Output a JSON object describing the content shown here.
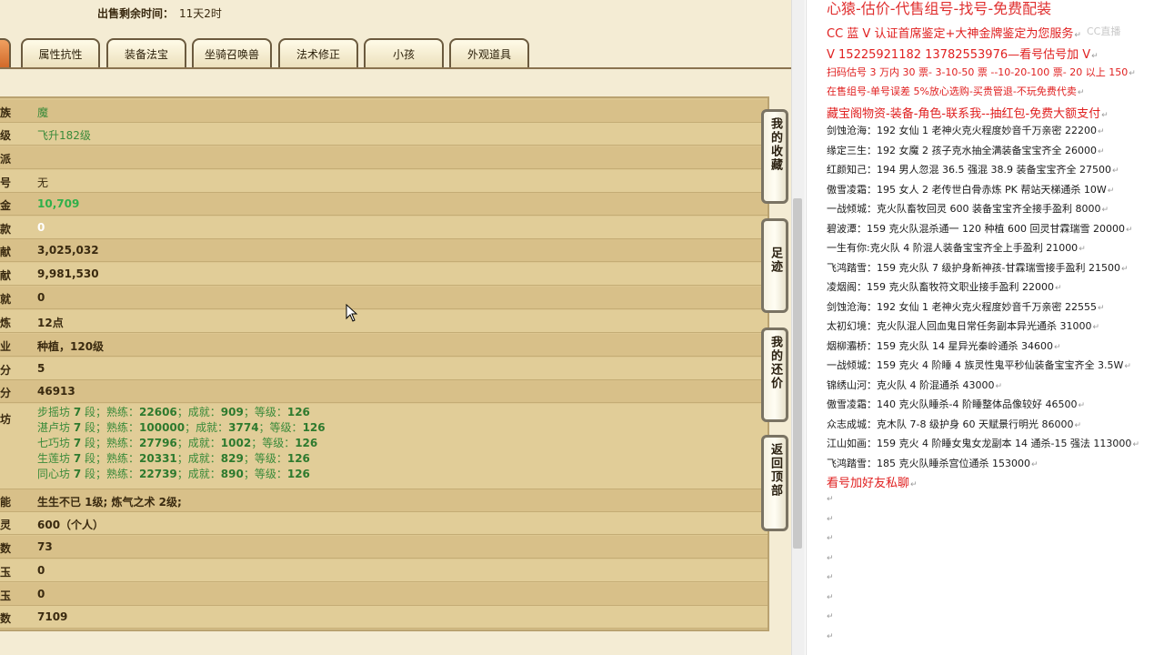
{
  "sale_time": {
    "label": "出售剩余时间：",
    "value": "11天2时"
  },
  "tabs": [
    {
      "label": ""
    },
    {
      "label": "属性抗性"
    },
    {
      "label": "装备法宝"
    },
    {
      "label": "坐骑召唤兽"
    },
    {
      "label": "法术修正"
    },
    {
      "label": "小孩"
    },
    {
      "label": "外观道具"
    }
  ],
  "rows": [
    {
      "label": "族",
      "value": "魔"
    },
    {
      "label": "级",
      "value": "飞升182级"
    },
    {
      "label": "派",
      "value": ""
    },
    {
      "label": "号",
      "value": "无"
    },
    {
      "label": "金",
      "value": "10,709"
    },
    {
      "label": "款",
      "value": "0"
    },
    {
      "label": "献",
      "value": "3,025,032"
    },
    {
      "label": "献",
      "value": "9,981,530"
    },
    {
      "label": "就",
      "value": "0"
    },
    {
      "label": "炼",
      "value": "12点"
    },
    {
      "label": "业",
      "value": "种植，120级"
    },
    {
      "label": "分",
      "value": "5"
    },
    {
      "label": "分",
      "value": "46913"
    }
  ],
  "workshop_label": "坊",
  "workshops": [
    {
      "name": "步摇坊",
      "rank": "7",
      "skill": "22606",
      "achieve": "909",
      "level": "126"
    },
    {
      "name": "湛卢坊",
      "rank": "7",
      "skill": "100000",
      "achieve": "3774",
      "level": "126"
    },
    {
      "name": "七巧坊",
      "rank": "7",
      "skill": "27796",
      "achieve": "1002",
      "level": "126"
    },
    {
      "name": "生莲坊",
      "rank": "7",
      "skill": "20331",
      "achieve": "829",
      "level": "126"
    },
    {
      "name": "同心坊",
      "rank": "7",
      "skill": "22739",
      "achieve": "890",
      "level": "126"
    }
  ],
  "workshop_words": {
    "duan": "段；",
    "shulian": "熟练：",
    "chengjiu": "；成就：",
    "dengji": "；等级："
  },
  "rows2": [
    {
      "label": "能",
      "value": "生生不已 1级; 炼气之术 2级;"
    },
    {
      "label": "灵",
      "value": "600（个人）"
    },
    {
      "label": "数",
      "value": "73"
    },
    {
      "label": "玉",
      "value": "0"
    },
    {
      "label": "玉",
      "value": "0"
    },
    {
      "label": "数",
      "value": "7109"
    }
  ],
  "side_buttons": [
    {
      "label": "我的收藏"
    },
    {
      "label": "足迹"
    },
    {
      "label": "我的还价"
    },
    {
      "label": "返回顶部"
    }
  ],
  "doc": {
    "title": "心猿-估价-代售组号-找号-免费配装",
    "watermark": "CC直播",
    "lines": [
      {
        "text": "CC 蓝 V 认证首席鉴定+大神金牌鉴定为您服务",
        "red": true,
        "big": true
      },
      {
        "text": "V 15225921182     13782553976—看号估号加 V",
        "red": true,
        "big": true
      },
      {
        "text": "扫码估号 3 万内 30 票- 3-10-50 票  --10-20-100 票- 20 以上 150",
        "red": true
      },
      {
        "text": "在售组号-单号误差 5%放心选购-买贵管退-不玩免费代卖",
        "red": true
      },
      {
        "text": "藏宝阁物资-装备-角色-联系我--抽红包-免费大额支付",
        "red": true,
        "big": true
      },
      {
        "text": "剑蚀沧海：192 女仙 1 老神火克火程度妙音千万亲密 22200"
      },
      {
        "text": "缘定三生：192 女魔 2 孩子克水抽全满装备宝宝齐全 26000"
      },
      {
        "text": "红颜知己：194 男人忽混 36.5 强混 38.9 装备宝宝齐全 27500"
      },
      {
        "text": "傲雪凌霜：195 女人 2 老传世白骨赤炼 PK 帮站天梯通杀 10W"
      },
      {
        "text": "一战倾城：克火队畜牧回灵 600 装备宝宝齐全接手盈利 8000"
      },
      {
        "text": "碧波潭：159 克火队混杀通一 120 种植 600 回灵甘霖瑞雪 20000"
      },
      {
        "text": "一生有你:克火队 4 阶混人装备宝宝齐全上手盈利 21000"
      },
      {
        "text": "飞鸿踏雪：159 克火队 7 级护身新神孩-甘霖瑞雪接手盈利 21500"
      },
      {
        "text": "凌烟阁：159 克火队畜牧符文职业接手盈利 22000"
      },
      {
        "text": "剑蚀沧海：192 女仙 1 老神火克火程度妙音千万亲密 22555"
      },
      {
        "text": "太初幻境：克火队混人回血鬼日常任务副本异光通杀 31000"
      },
      {
        "text": "烟柳灞桥：159 克火队 14 星异光秦岭通杀 34600"
      },
      {
        "text": "一战倾城：159 克火 4 阶睡 4 族灵性鬼平秒仙装备宝宝齐全 3.5W"
      },
      {
        "text": "锦绣山河：克火队 4 阶混通杀 43000"
      },
      {
        "text": "傲雪凌霜：140 克火队睡杀-4 阶睡整体品像较好 46500"
      },
      {
        "text": "众志成城：克木队 7-8 级护身 60 天赋景行明光 86000"
      },
      {
        "text": "江山如画：159 克火 4 阶睡女鬼女龙副本 14 通杀-15 强法 113000"
      },
      {
        "text": "飞鸿踏雪：185 克火队睡杀宫位通杀 153000"
      },
      {
        "text": "看号加好友私聊",
        "red": true,
        "big": true
      }
    ],
    "return_mark": "↵"
  }
}
